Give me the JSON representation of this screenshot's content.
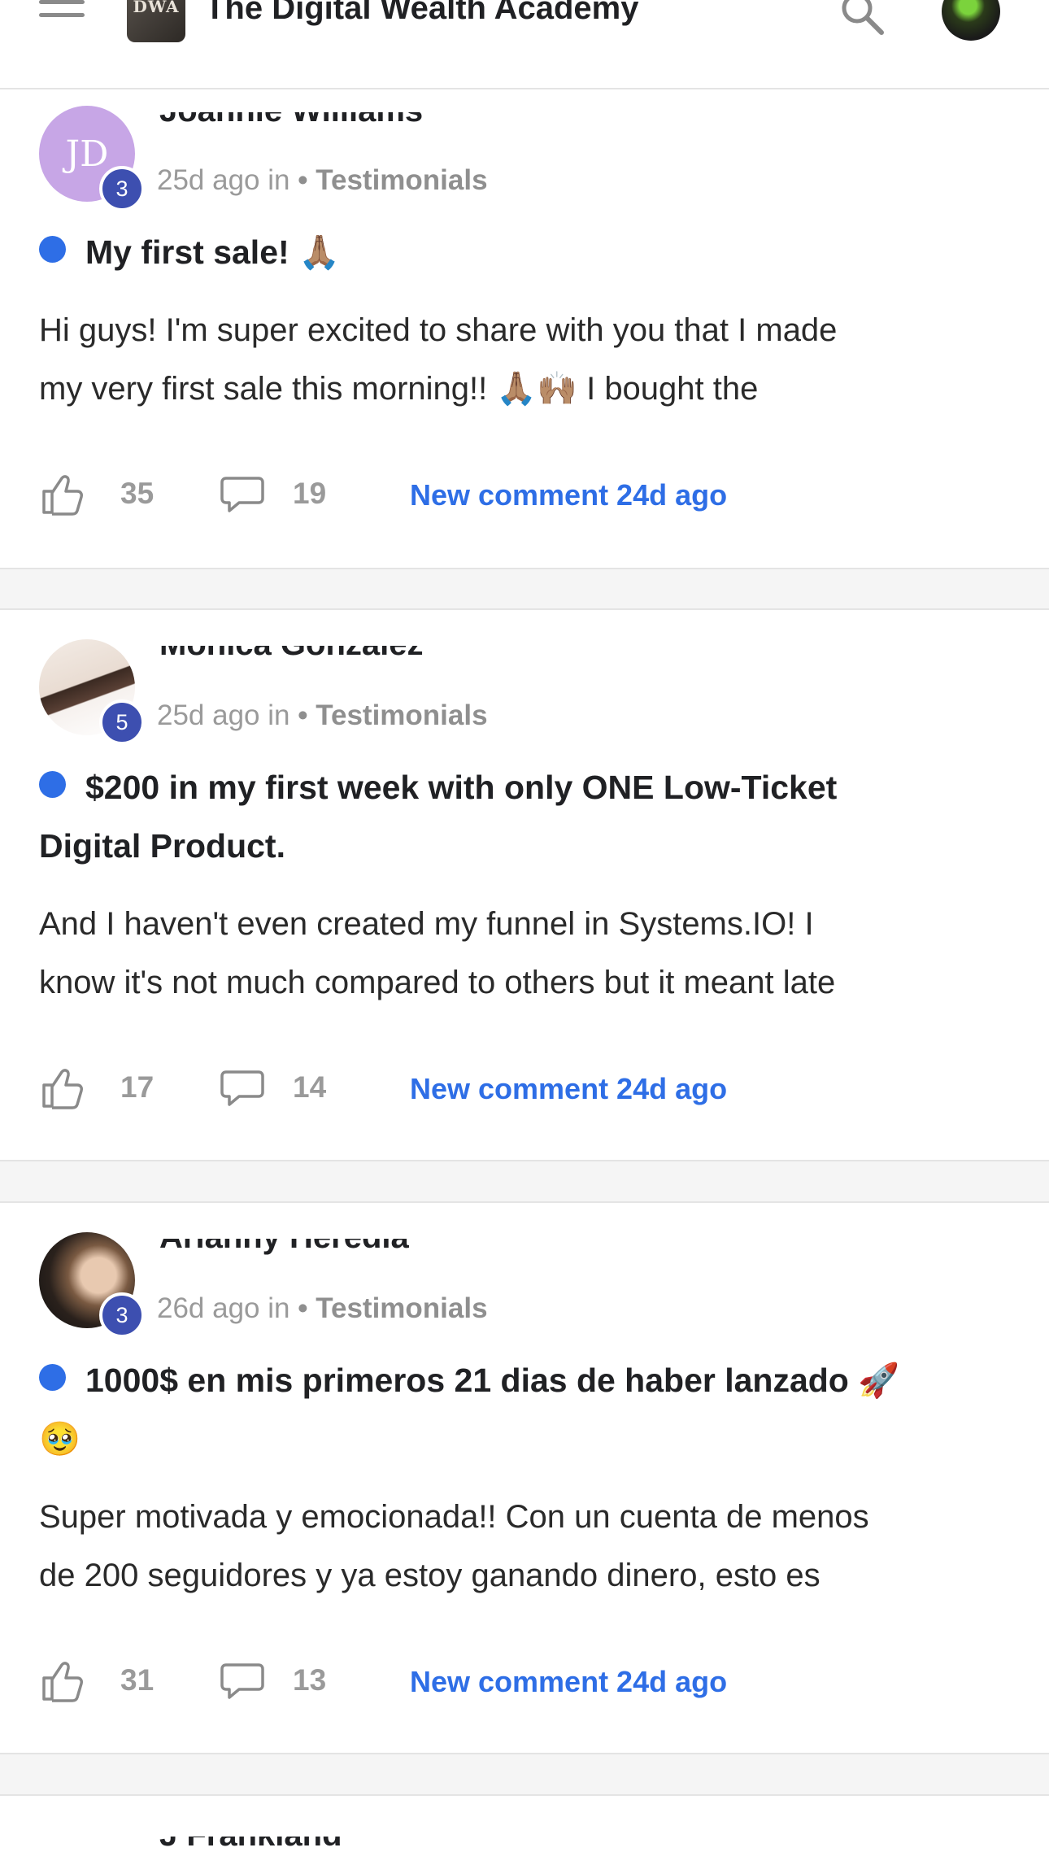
{
  "header": {
    "app_title": "The Digital Wealth Academy",
    "logo_text": "DWA",
    "icons": {
      "menu": "hamburger-menu-icon",
      "search": "search-icon",
      "profile": "user-avatar"
    }
  },
  "posts": [
    {
      "author": "Joannie Williams",
      "level": "3",
      "time": "25d ago in",
      "category": "• Testimonials",
      "title": "My first sale! 🙏🏽",
      "body_line1": "Hi guys! I'm super excited to share with you that I made",
      "body_line2": "my very first sale this morning!! 🙏🏽🙌🏽 I bought the",
      "likes": "35",
      "comments": "19",
      "new_comment": "New comment 24d ago"
    },
    {
      "author": "Monica Gonzalez",
      "level": "5",
      "time": "25d ago in",
      "category": "• Testimonials",
      "title_line1": "$200 in my first week with only ONE Low-Ticket",
      "title_line2": "Digital Product.",
      "body_line1": "And I haven't even created my funnel in Systems.IO! I",
      "body_line2": "know it's not much compared to others but it meant late",
      "likes": "17",
      "comments": "14",
      "new_comment": "New comment 24d ago"
    },
    {
      "author": "Arianny Heredia",
      "level": "3",
      "time": "26d ago in",
      "category": "• Testimonials",
      "title_line1": "1000$ en mis primeros 21 dias de haber lanzado 🚀",
      "title_line2": "🥹",
      "body_line1": "Super motivada y emocionada!! Con un cuenta de menos",
      "body_line2": "de 200 seguidores y ya estoy ganando dinero, esto es",
      "likes": "31",
      "comments": "13",
      "new_comment": "New comment 24d ago"
    },
    {
      "author": "J Frankland"
    }
  ],
  "colors": {
    "accent": "#2e6ee6",
    "badge": "#3d4fb0",
    "muted": "#9a9a9a"
  }
}
